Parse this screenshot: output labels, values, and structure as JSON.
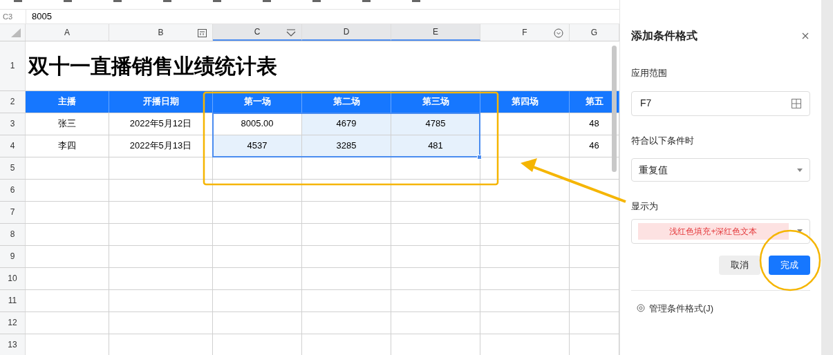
{
  "formula_bar": {
    "cell_ref": "C3",
    "value": "8005"
  },
  "columns": [
    {
      "label": "A",
      "selected": false
    },
    {
      "label": "B",
      "selected": false
    },
    {
      "label": "C",
      "selected": true
    },
    {
      "label": "D",
      "selected": true
    },
    {
      "label": "E",
      "selected": true
    },
    {
      "label": "F",
      "selected": false
    },
    {
      "label": "G",
      "selected": false
    }
  ],
  "title_row": {
    "number": "1",
    "text": "双十一直播销售业绩统计表"
  },
  "header_row": {
    "number": "2",
    "cells": [
      "主播",
      "开播日期",
      "第一场",
      "第二场",
      "第三场",
      "第四场",
      "第五"
    ]
  },
  "rows": [
    {
      "number": "3",
      "cells": [
        {
          "text": "张三",
          "selected": false
        },
        {
          "text": "2022年5月12日",
          "selected": false
        },
        {
          "text": "8005.00",
          "selected": false
        },
        {
          "text": "4679",
          "selected": true
        },
        {
          "text": "4785",
          "selected": true
        },
        {
          "text": "",
          "selected": false
        },
        {
          "text": "48",
          "selected": false
        }
      ]
    },
    {
      "number": "4",
      "cells": [
        {
          "text": "李四",
          "selected": false
        },
        {
          "text": "2022年5月13日",
          "selected": false
        },
        {
          "text": "4537",
          "selected": true
        },
        {
          "text": "3285",
          "selected": true
        },
        {
          "text": "481",
          "selected": true
        },
        {
          "text": "",
          "selected": false
        },
        {
          "text": "46",
          "selected": false
        }
      ]
    },
    {
      "number": "5",
      "cells": []
    },
    {
      "number": "6",
      "cells": []
    },
    {
      "number": "7",
      "cells": []
    },
    {
      "number": "8",
      "cells": []
    },
    {
      "number": "9",
      "cells": []
    },
    {
      "number": "10",
      "cells": []
    },
    {
      "number": "11",
      "cells": []
    },
    {
      "number": "12",
      "cells": []
    },
    {
      "number": "13",
      "cells": []
    }
  ],
  "panel": {
    "title": "添加条件格式",
    "range_label": "应用范围",
    "range_value": "F7",
    "condition_label": "符合以下条件时",
    "condition_value": "重复值",
    "display_label": "显示为",
    "display_value": "浅红色填充+深红色文本",
    "cancel": "取消",
    "done": "完成",
    "manage": "管理条件格式(J)"
  }
}
